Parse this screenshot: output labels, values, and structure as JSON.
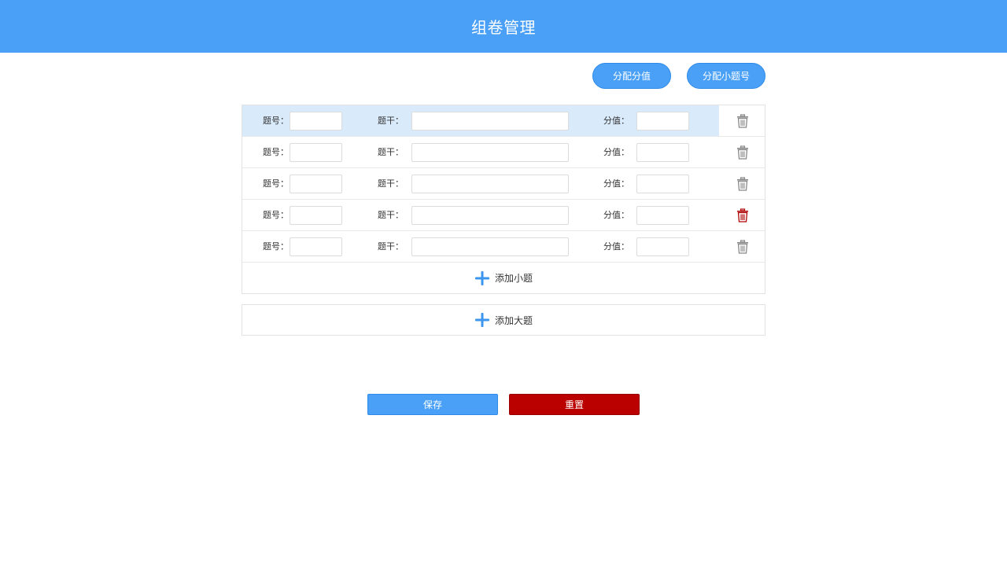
{
  "header": {
    "title": "组卷管理"
  },
  "toolbar": {
    "assign_score_label": "分配分值",
    "assign_number_label": "分配小题号"
  },
  "question_rows": [
    {
      "number_label": "题号：",
      "number_value": "",
      "stem_label": "题干：",
      "stem_value": "",
      "score_label": "分值：",
      "score_value": "",
      "highlighted": true,
      "trash_color": "#888888"
    },
    {
      "number_label": "题号：",
      "number_value": "",
      "stem_label": "题干：",
      "stem_value": "",
      "score_label": "分值：",
      "score_value": "",
      "highlighted": false,
      "trash_color": "#888888"
    },
    {
      "number_label": "题号：",
      "number_value": "",
      "stem_label": "题干：",
      "stem_value": "",
      "score_label": "分值：",
      "score_value": "",
      "highlighted": false,
      "trash_color": "#888888"
    },
    {
      "number_label": "题号：",
      "number_value": "",
      "stem_label": "题干：",
      "stem_value": "",
      "score_label": "分值：",
      "score_value": "",
      "highlighted": false,
      "trash_color": "#b00000"
    },
    {
      "number_label": "题号：",
      "number_value": "",
      "stem_label": "题干：",
      "stem_value": "",
      "score_label": "分值：",
      "score_value": "",
      "highlighted": false,
      "trash_color": "#888888"
    }
  ],
  "add_sub_question_label": "添加小题",
  "add_main_question_label": "添加大题",
  "actions": {
    "save_label": "保存",
    "reset_label": "重置"
  },
  "colors": {
    "accent": "#4aa0f7",
    "danger": "#bb0000",
    "row_highlight": "#d9eafb"
  },
  "icons": {
    "delete": "trash-icon",
    "add": "plus-icon"
  }
}
